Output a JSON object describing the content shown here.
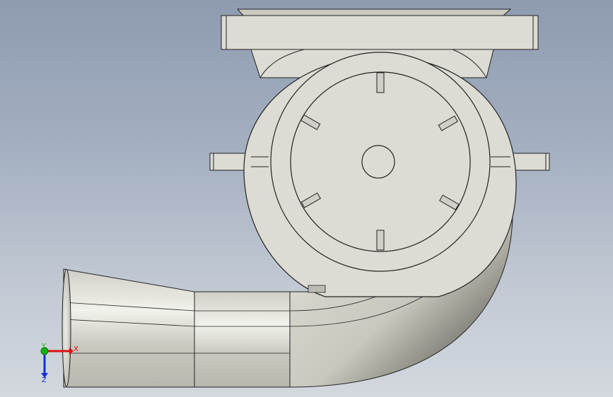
{
  "view": {
    "background_top": "#8e9bb0",
    "background_bottom": "#d3d8de",
    "model_name": "volute-pump-housing",
    "part_color": "#dcdcd4"
  },
  "triad": {
    "x_label": "X",
    "y_label": "Y",
    "z_label": "Z",
    "x_color": "#e01010",
    "y_color": "#10b010",
    "z_color": "#1030d0"
  }
}
